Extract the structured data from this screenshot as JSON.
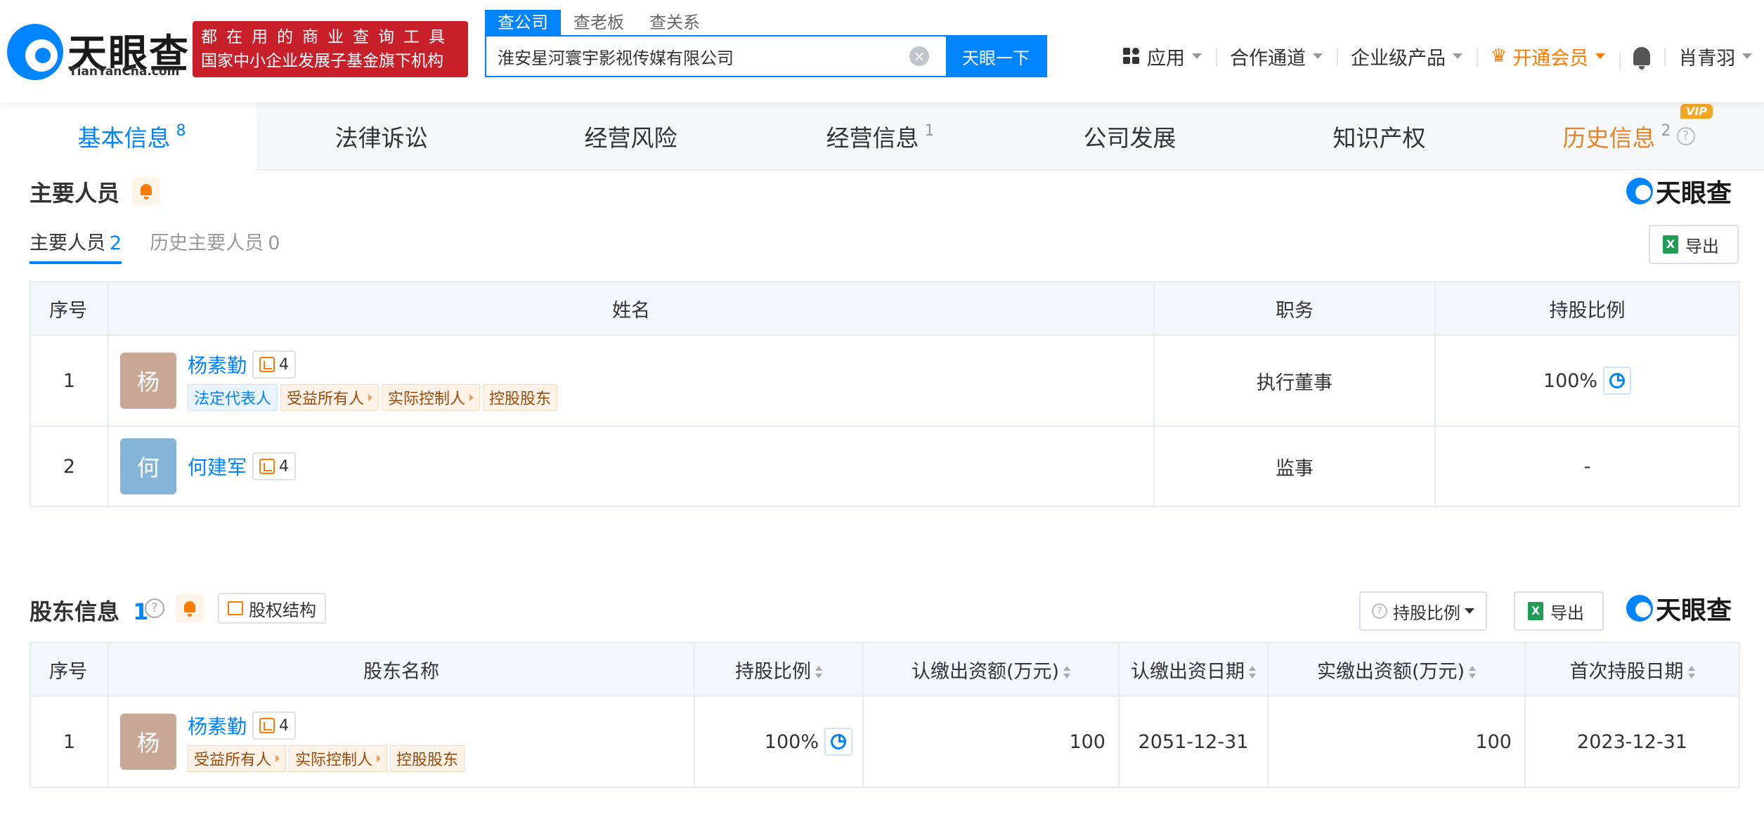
{
  "header": {
    "logo_name": "天眼查",
    "logo_sub": "TianYanCha.com",
    "slogan_line1": "都在用的商业查询工具",
    "slogan_line2": "国家中小企业发展子基金旗下机构",
    "search_tabs": [
      "查公司",
      "查老板",
      "查关系"
    ],
    "search_value": "淮安星河寰宇影视传媒有限公司",
    "search_button": "天眼一下",
    "nav": {
      "apps": "应用",
      "channel": "合作通道",
      "enterprise": "企业级产品",
      "vip": "开通会员",
      "user": "肖青羽"
    }
  },
  "module_tabs": [
    {
      "label": "基本信息",
      "count": "8"
    },
    {
      "label": "法律诉讼",
      "count": ""
    },
    {
      "label": "经营风险",
      "count": ""
    },
    {
      "label": "经营信息",
      "count": "1"
    },
    {
      "label": "公司发展",
      "count": ""
    },
    {
      "label": "知识产权",
      "count": ""
    },
    {
      "label": "历史信息",
      "count": "2",
      "badge": "VIP"
    }
  ],
  "brand_name": "天眼查",
  "personnel": {
    "title": "主要人员",
    "tabs": [
      {
        "label": "主要人员",
        "count": "2"
      },
      {
        "label": "历史主要人员",
        "count": "0"
      }
    ],
    "export_label": "导出",
    "columns": [
      "序号",
      "姓名",
      "职务",
      "持股比例"
    ],
    "rows": [
      {
        "index": "1",
        "avatar": "杨",
        "name": "杨素勤",
        "relations": "4",
        "tags": [
          "法定代表人",
          "受益所有人",
          "实际控制人",
          "控股股东"
        ],
        "position": "执行董事",
        "ratio": "100%"
      },
      {
        "index": "2",
        "avatar": "何",
        "name": "何建军",
        "relations": "4",
        "tags": [],
        "position": "监事",
        "ratio": "-"
      }
    ]
  },
  "shareholders": {
    "title": "股东信息",
    "count": "1",
    "help": "?",
    "equity_label": "股权结构",
    "ratio_filter_label": "持股比例",
    "export_label": "导出",
    "columns": [
      "序号",
      "股东名称",
      "持股比例",
      "认缴出资额(万元)",
      "认缴出资日期",
      "实缴出资额(万元)",
      "首次持股日期"
    ],
    "rows": [
      {
        "index": "1",
        "avatar": "杨",
        "name": "杨素勤",
        "relations": "4",
        "tags": [
          "受益所有人",
          "实际控制人",
          "控股股东"
        ],
        "ratio": "100%",
        "subscribed_amount": "100",
        "subscribed_date": "2051-12-31",
        "paid_amount": "100",
        "first_hold_date": "2023-12-31"
      }
    ]
  },
  "colors": {
    "primary": "#0084ff",
    "accent": "#ff7a00",
    "slogan_bg": "#c8202a",
    "table_header": "#f2f7fc"
  }
}
